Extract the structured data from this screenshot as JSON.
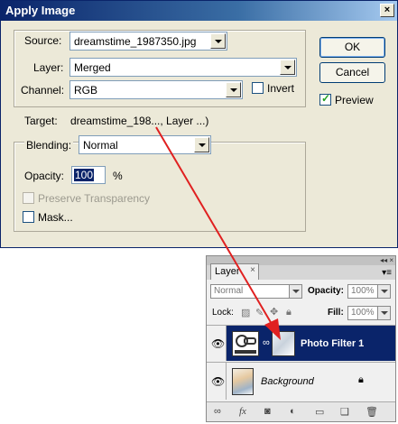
{
  "dialog": {
    "title": "Apply Image",
    "close_glyph": "×",
    "source": {
      "label": "Source:",
      "value": "dreamstime_1987350.jpg"
    },
    "layer": {
      "label": "Layer:",
      "value": "Merged"
    },
    "channel": {
      "label": "Channel:",
      "value": "RGB"
    },
    "invert": {
      "label": "Invert",
      "checked": false
    },
    "target": {
      "label": "Target:",
      "value": "dreamstime_198..., Layer ...)"
    },
    "blending": {
      "label": "Blending:",
      "value": "Normal"
    },
    "opacity": {
      "label": "Opacity:",
      "value": "100",
      "unit": "%"
    },
    "preserve_transparency": {
      "label": "Preserve Transparency",
      "checked": false,
      "enabled": false
    },
    "mask": {
      "label": "Mask...",
      "checked": false
    },
    "buttons": {
      "ok": "OK",
      "cancel": "Cancel"
    },
    "preview": {
      "label": "Preview",
      "checked": true
    }
  },
  "layers_panel": {
    "tab_label": "Layers",
    "tab_label_visible": "Layer",
    "tab_close": "×",
    "menu_glyph": "▾≡",
    "collapse_glyph": "◂◂ ×",
    "blend_mode": "Normal",
    "opacity_label": "Opacity:",
    "opacity_value": "100%",
    "lock_label": "Lock:",
    "fill_label": "Fill:",
    "fill_value": "100%",
    "layers": [
      {
        "name": "Photo Filter 1",
        "selected": true,
        "visible": true
      },
      {
        "name": "Background",
        "selected": false,
        "visible": true,
        "locked": true
      }
    ],
    "bottom_icons": [
      "link-icon",
      "fx-icon",
      "mask-icon",
      "adjustment-icon",
      "folder-icon",
      "new-layer-icon",
      "trash-icon"
    ]
  },
  "colors": {
    "title_bar": "#0a246a",
    "selection": "#0a246a",
    "arrow": "#e02020",
    "dialog_bg": "#ece9d8"
  }
}
